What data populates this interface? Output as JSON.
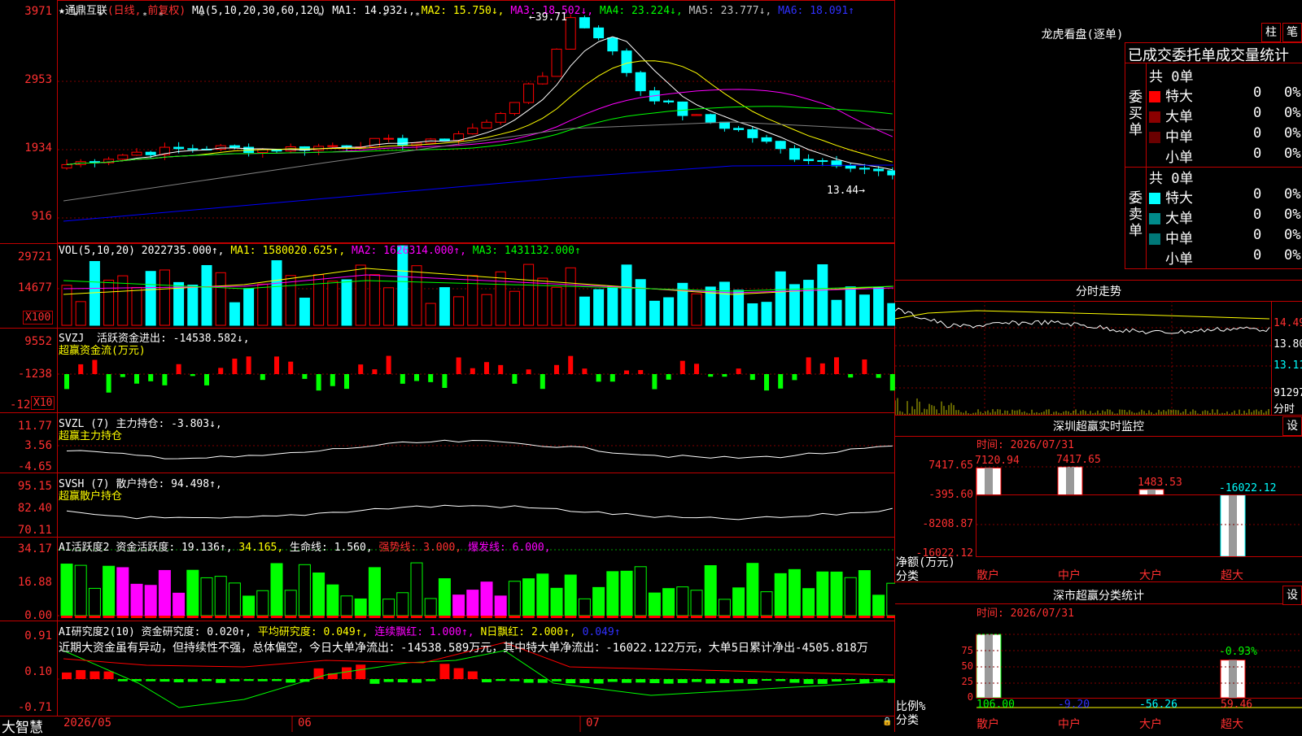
{
  "stock_header": {
    "star": "★",
    "name": "通鼎互联",
    "mode": "(日线, 前复权)",
    "ma_label": "MA(5,10,20,30,60,120)",
    "ma1": "MA1: 14.932↓,",
    "ma2": "MA2: 15.750↓,",
    "ma3": "MA3: 18.502↓,",
    "ma4": "MA4: 23.224↓,",
    "ma5": "MA5: 23.777↓,",
    "ma6": "MA6: 18.091↑"
  },
  "price_axis": [
    "3971",
    "2953",
    "1934",
    "916"
  ],
  "price_annot": {
    "high": "39.71",
    "low": "13.44"
  },
  "vol_header": {
    "label": "VOL(5,10,20)",
    "val": "2022735.000↑,",
    "ma1": "MA1: 1580020.625↑,",
    "ma2": "MA2: 1626314.000↑,",
    "ma3": "MA3: 1431132.000↑"
  },
  "vol_axis": [
    "29721",
    "14677"
  ],
  "unit_x100": "X100",
  "svzj_header": {
    "label": "SVZJ",
    "desc": "活跃资金进出: -14538.582↓,",
    "sub": "超赢资金流(万元)"
  },
  "svzj_axis": [
    "9552",
    "-1238",
    "-12"
  ],
  "unit_x10": "X10",
  "svzl_header": {
    "label": "SVZL (7)",
    "desc": "主力持仓: -3.803↓,",
    "sub": "超赢主力持仓"
  },
  "svzl_axis": [
    "11.77",
    "3.56",
    "-4.65"
  ],
  "svsh_header": {
    "label": "SVSH (7)",
    "desc": "散户持仓: 94.498↑,",
    "sub": "超赢散户持仓"
  },
  "svsh_axis": [
    "95.15",
    "82.40",
    "70.11"
  ],
  "ai1_header": {
    "label": "AI活跃度2",
    "a": "资金活跃度: 19.136↑,",
    "b": "34.165,",
    "c": "生命线: 1.560,",
    "d": "强势线: 3.000,",
    "e": "爆发线: 6.000,"
  },
  "ai1_axis": [
    "34.17",
    "16.88",
    "0.00"
  ],
  "ai2_header": {
    "label": "AI研究度2(10)",
    "a": "资金研究度: 0.020↑,",
    "b": "平均研究度: 0.049↑,",
    "c": "连续飘红: 1.000↑,",
    "d": "N日飘红: 2.000↑,",
    "e": "0.049↑"
  },
  "ai2_text": "近期大资金虽有异动，但持续性不强，总体偏空，今日大单净流出：-14538.589万元，其中特大单净流出：-16022.122万元，大单5日累计净出-4505.818万",
  "ai2_axis": [
    "0.91",
    "0.10",
    "-0.71"
  ],
  "date_axis": [
    "2026/05",
    "06",
    "07"
  ],
  "brand": "大智慧",
  "right_panel": {
    "tab1": "柱",
    "tab2": "笔",
    "title": "龙虎看盘(逐单)",
    "stats_header": "已成交委托单成交量统计",
    "buy": {
      "label": "委买单",
      "total": "共 0单",
      "rows": [
        {
          "name": "特大",
          "v": "0",
          "p": "0%",
          "color": "#ff0000"
        },
        {
          "name": "大单",
          "v": "0",
          "p": "0%",
          "color": "#8b0000"
        },
        {
          "name": "中单",
          "v": "0",
          "p": "0%",
          "color": "#6a0000"
        },
        {
          "name": "小单",
          "v": "0",
          "p": "0%",
          "color": "#000000"
        }
      ]
    },
    "sell": {
      "label": "委卖单",
      "total": "共 0单",
      "rows": [
        {
          "name": "特大",
          "v": "0",
          "p": "0%",
          "color": "#00ffff"
        },
        {
          "name": "大单",
          "v": "0",
          "p": "0%",
          "color": "#008b8b"
        },
        {
          "name": "中单",
          "v": "0",
          "p": "0%",
          "color": "#007878"
        },
        {
          "name": "小单",
          "v": "0",
          "p": "0%",
          "color": "#000000"
        }
      ]
    },
    "intraday": {
      "title": "分时走势",
      "p1": "14.49",
      "p2": "13.80",
      "p3": "13.11",
      "vol": "91297",
      "unit": "分时"
    },
    "monitor": {
      "title": "深圳超赢实时监控",
      "settings": "设",
      "time": "时间: 2026/07/31",
      "axis": [
        "7417.65",
        "-395.60",
        "-8208.87",
        "-16022.12"
      ],
      "ylabel": "净额(万元)",
      "xlabel": "分类",
      "bars": [
        {
          "name": "散户",
          "value": 7120.94,
          "label": "7120.94"
        },
        {
          "name": "中户",
          "value": 7417.65,
          "label": "7417.65"
        },
        {
          "name": "大户",
          "value": 1483.53,
          "label": "1483.53"
        },
        {
          "name": "超大",
          "value": -16022.12,
          "label": "-16022.12"
        }
      ]
    },
    "classify": {
      "title": "深市超赢分类统计",
      "settings": "设",
      "time": "时间: 2026/07/31",
      "axis": [
        "75",
        "50",
        "25",
        "0"
      ],
      "ylabel": "比例%",
      "xlabel": "分类",
      "bars": [
        {
          "name": "散户",
          "value": 106.0,
          "label": "106.00"
        },
        {
          "name": "中户",
          "value": -9.2,
          "label": "-9.20"
        },
        {
          "name": "大户",
          "value": -56.26,
          "label": "-56.26"
        },
        {
          "name": "超大",
          "value": 59.46,
          "label": "59.46"
        }
      ],
      "small_label": "-0.93%"
    }
  },
  "colors": {
    "up": "#ff0000",
    "down": "#00ffff",
    "grid": "#c00000",
    "ma1": "#ffffff",
    "ma2": "#ffff00",
    "ma3": "#ff00ff",
    "ma4": "#00ff00",
    "ma5": "#808080",
    "ma6": "#0000ff"
  }
}
